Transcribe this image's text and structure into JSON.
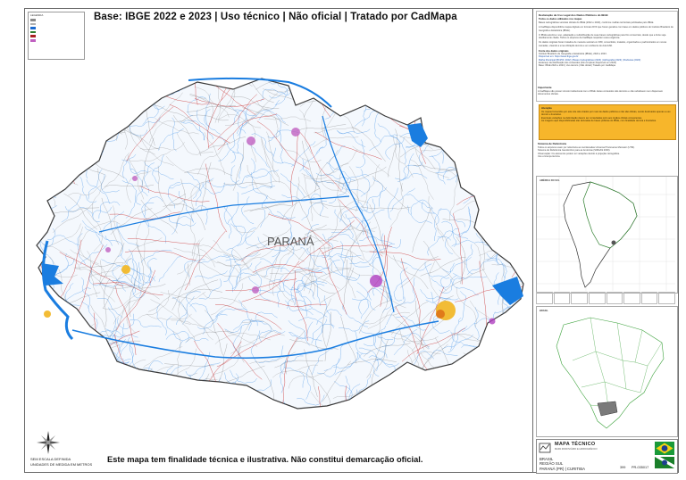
{
  "title": "Base: IBGE 2022 e 2023 | Uso técnico | Não oficial | Tratado por CadMapa",
  "map_label": "PARANÁ",
  "disclaimer": "Este mapa tem finalidade técnica e ilustrativa. Não constitui demarcação oficial.",
  "scale_text": [
    "SEM ESCALA DEFINIDA",
    "UNIDADES DE MEDIDA EM METROS"
  ],
  "legend": {
    "header": "LEGENDA",
    "items": [
      {
        "color": "#8a8a8a"
      },
      {
        "color": "#b0b0b0"
      },
      {
        "color": "#1a6ad0"
      },
      {
        "color": "#2f7f2f"
      },
      {
        "color": "#aa2222"
      },
      {
        "color": "#c060c0"
      }
    ]
  },
  "right_panel": {
    "sec1_title": "Declaração de Uso Legal dos Dados Públicos do IBGE",
    "sec1_sub": "Todos os dados utilizados nos mapas",
    "sec1_lines": [
      "Bases cartográficas vetoriais oficiais do IBGE (2022 e 2023), conforme malhas territoriais publicadas pelo IBGE.",
      "A CadMapa disponibiliza mapas digitais em formato DXF que foram gerados com base em dados públicos do Instituto Brasileiro de Geografia e Estatística (IBGE).",
      "O IBGE autoriza o uso, adaptação e redistribuição de suas bases cartográficas para fins comerciais, desde que a fonte seja devidamente citada. Todos os arquivos da CadMapa respeitam essa exigência.",
      "Os dados originais foram tratados de maneira vetorial em DXF, convertidos, tratados, organizados e padronizados em novas camadas, visando a uma utilização técnica e em ambiente de AutoCAD."
    ],
    "sec2_title": "Fonte dos dados originais",
    "sec2_lines": [
      "Instituto Brasileiro de Geografia e Estatística (IBGE), 2022 e 2023.",
      "Disponível em: https://www.ibge.gov.br",
      "Malha Municipal (BC250, 2022) | Bases Cartográficas (2023) | Hidrografia (2023) | Rodovias (2023)",
      "Endereço da distribuição dos conteúdos (link completo disponível em 2023)",
      "Base: IBGE 2022 e 2023 | Uso técnico | Não oficial | Tratado por CadMapa"
    ],
    "sec3_title": "Importante",
    "sec3_lines": [
      "A CadMapa não possui vínculo institucional com o IBGE. Estes conteúdos são técnicos e não substituem nem dispensam documentos oficiais."
    ],
    "alert_title": "Atenção",
    "alert_lines": [
      "Os mapas fornecidos por este site são criados por meio de dados públicos e não são oficiais, sendo destinados apenas a uso técnico e ilustrativo.",
      "Eventuais variações na delimitação devem ser consultadas junto aos órgãos oficiais competentes.",
      "As imagens aqui disponibilizadas são derivadas de bases públicas do IBGE, com finalidade técnica e ilustrativa."
    ],
    "sec4_title": "Sistema de Referência",
    "sec4_lines": [
      "Todos os arquivos usam por referência as coordenadas Universal Transverse Mercator (UTM).",
      "Sistema de Referência Geocêntrico para as Américas (SIRGAS 2000).",
      "Observação: Os elementos podem ter variações devido à projeção cartográfica.",
      "Uso e licença técnica."
    ],
    "insetA_label": "AMÉRICA DO SUL",
    "insetB_label": "BRASIL",
    "row_boxes": [
      "",
      "",
      "",
      "",
      "",
      "",
      "",
      ""
    ]
  },
  "title_block": {
    "brand": "CadMapa",
    "title": "MAPA TÉCNICO",
    "subtitle": "MAPA RODOVIÁRIO E HIDROGRÁFICO",
    "location": [
      "BRASIL",
      "REGIÃO SUL",
      "PARANÁ (PR) | CURITIBA"
    ],
    "number": "399",
    "code": "PR-035017"
  },
  "colors": {
    "water": "#1a7de0",
    "roads_primary": "#c62020",
    "roads_secondary": "#5a5a5a",
    "urban": "#f2b51f",
    "urban_alt": "#b040c0",
    "alert_bg": "#f7b62b"
  }
}
